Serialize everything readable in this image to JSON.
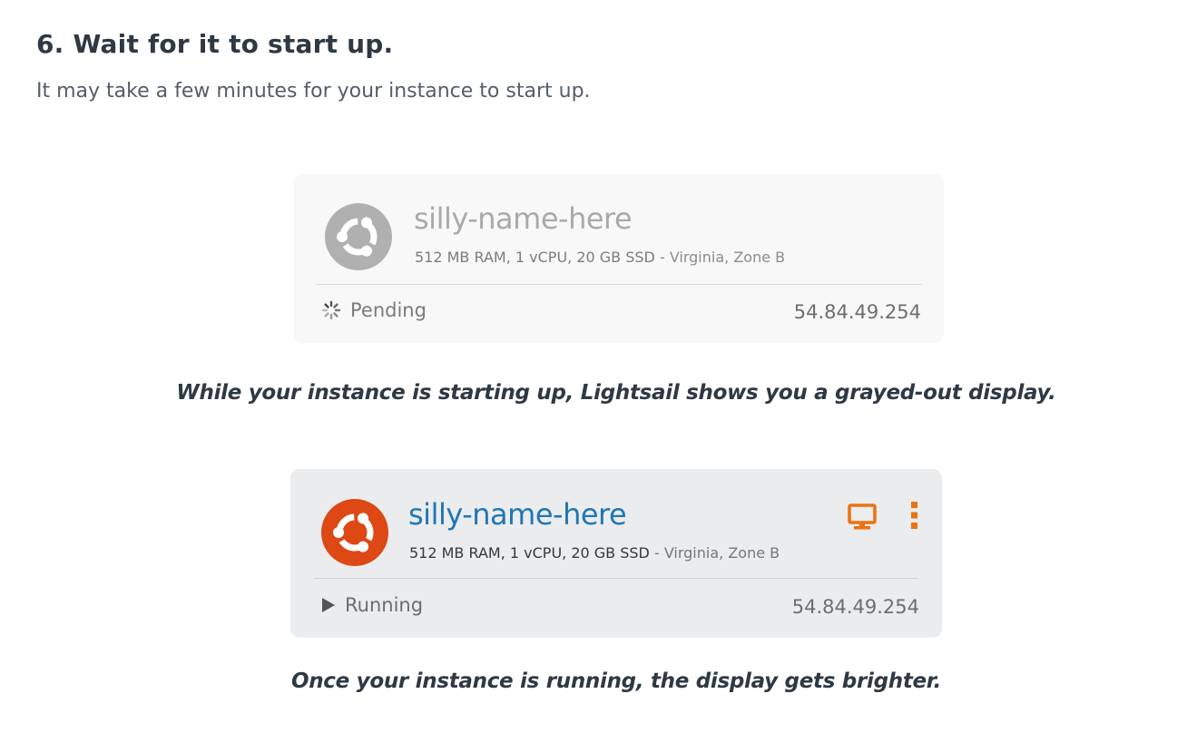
{
  "step": {
    "title": "6. Wait for it to start up.",
    "description": "It may take a few minutes for your instance to start up."
  },
  "pending_card": {
    "instance_name": "silly-name-here",
    "spec": "512 MB RAM, 1 vCPU, 20 GB SSD",
    "separator": " - ",
    "region": "Virginia, Zone B",
    "status": "Pending",
    "status_icon": "spinner-icon",
    "ip": "54.84.49.254",
    "logo_color": "#b0b0b0"
  },
  "pending_caption": "While your instance is starting up, Lightsail shows you a grayed-out display.",
  "running_card": {
    "instance_name": "silly-name-here",
    "spec": "512 MB RAM, 1 vCPU, 20 GB SSD",
    "separator": " - ",
    "region": "Virginia, Zone B",
    "status": "Running",
    "status_icon": "play-icon",
    "ip": "54.84.49.254",
    "logo_color": "#dd4814",
    "actions": [
      "connect-terminal-icon",
      "more-options-icon"
    ],
    "action_color": "#ec7211"
  },
  "running_caption": "Once your instance is running, the display gets brighter."
}
